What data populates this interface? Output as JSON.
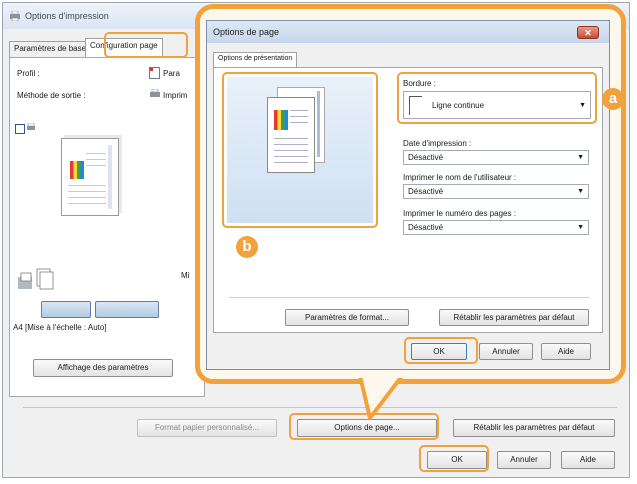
{
  "background_window": {
    "title": "Options d'impression",
    "tabs": [
      "Paramètres de base",
      "Configuration page"
    ],
    "profile_label": "Profil :",
    "profile_value": "Para",
    "output_label": "Méthode de sortie :",
    "output_value": "Imprim",
    "paper_info": "A4 [Mise à l'échelle : Auto]",
    "view_settings_button": "Affichage des paramètres",
    "side_label": "Mi",
    "custom_paper_button": "Format papier personnalisé...",
    "page_options_button": "Options de page...",
    "restore_defaults_button": "Rétablir les paramètres par défaut",
    "ok_button": "OK",
    "cancel_button": "Annuler",
    "help_button": "Aide"
  },
  "dialog": {
    "title": "Options de page",
    "close_glyph": "✕",
    "tab": "Options de présentation",
    "border_label": "Bordure :",
    "border_value": "Ligne continue",
    "print_date_label": "Date d'impression :",
    "print_date_value": "Désactivé",
    "print_user_label": "Imprimer le nom de l'utilisateur :",
    "print_user_value": "Désactivé",
    "print_page_label": "Imprimer le numéro des pages :",
    "print_page_value": "Désactivé",
    "format_settings_button": "Paramètres de format...",
    "restore_defaults_button": "Rétablir les paramètres par défaut",
    "ok_button": "OK",
    "cancel_button": "Annuler",
    "help_button": "Aide"
  },
  "callouts": {
    "a": "a",
    "b": "b"
  },
  "colors": {
    "highlight": "#f2a23c"
  }
}
